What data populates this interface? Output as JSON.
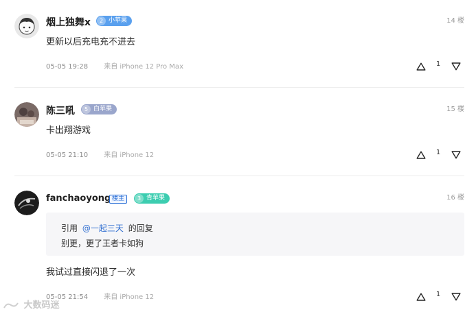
{
  "posts": [
    {
      "username": "烟上独舞x",
      "level": "2",
      "badge": "小苹果",
      "badge_color": "#5aa0ee",
      "floor": "14 楼",
      "content": "更新以后充电充不进去",
      "date": "05-05 19:28",
      "device": "来自 iPhone 12 Pro Max",
      "votes": "1"
    },
    {
      "username": "陈三吼",
      "level": "5",
      "badge": "白苹果",
      "badge_color": "#9aa6cc",
      "floor": "15 楼",
      "content": "卡出翔游戏",
      "date": "05-05 21:10",
      "device": "来自 iPhone 12",
      "votes": "1"
    },
    {
      "username": "fanchaoyong",
      "owner_tag": "楼主",
      "level": "3",
      "badge": "青苹果",
      "badge_color": "#3ccdb0",
      "floor": "16 楼",
      "quote_prefix": "引用",
      "quote_user": "@一起三天",
      "quote_suffix": "的回复",
      "quote_text": "别更，更了王者卡如狗",
      "content": "我试过直接闪退了一次",
      "date": "05-05 21:54",
      "device": "来自 iPhone 12",
      "votes": "1"
    }
  ],
  "watermark": "大数码迷",
  "icons": {
    "upvote": "triangle-up-icon",
    "downvote": "triangle-down-icon"
  }
}
